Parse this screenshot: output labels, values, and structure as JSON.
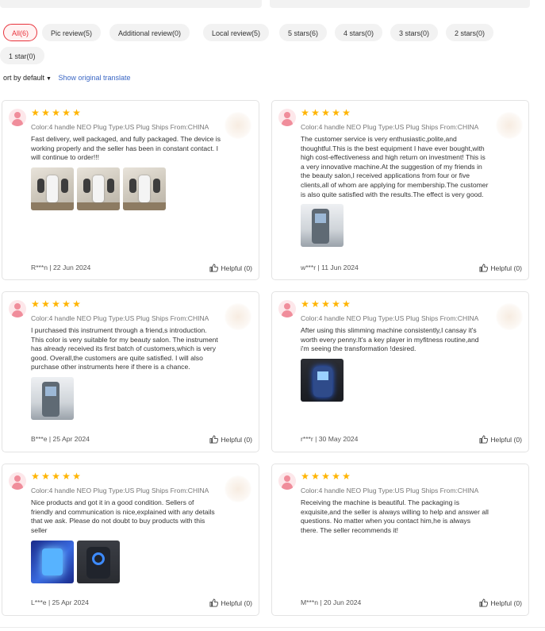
{
  "filters": [
    {
      "label": "All(6)",
      "active": true
    },
    {
      "label": "Pic review(5)",
      "active": false
    },
    {
      "label": "Additional review(0)",
      "active": false
    },
    {
      "label": "Local review(5)",
      "active": false
    },
    {
      "label": "5 stars(6)",
      "active": false
    },
    {
      "label": "4 stars(0)",
      "active": false
    },
    {
      "label": "3 stars(0)",
      "active": false
    },
    {
      "label": "2 stars(0)",
      "active": false
    },
    {
      "label": "1 star(0)",
      "active": false
    }
  ],
  "sort": {
    "label": "ort by default",
    "translate_label": "Show original translate"
  },
  "colors": {
    "accent": "#e8333c",
    "star": "#ffb400",
    "link": "#3a66c4"
  },
  "reviews": [
    {
      "rating": 5,
      "variant": "Color:4 handle NEO Plug Type:US Plug Ships From:CHINA",
      "text": [
        "Fast delivery, well packaged, and fully packaged. The device is",
        "working properly and the seller has been in constant contact. I",
        "will continue to order!!!"
      ],
      "photos": [
        "beige",
        "beige",
        "beige"
      ],
      "author": "R***n | 22 Jun 2024",
      "helpful": "Helpful (0)"
    },
    {
      "rating": 5,
      "variant": "Color:4 handle NEO Plug Type:US Plug Ships From:CHINA",
      "text": [
        "The customer service is very enthusiastic,polite,and",
        "thoughtful.This is the best equipment I have ever bought,with",
        "high cost-effectiveness and high return on investment! This is",
        "a very innovative machine.At the suggestion of my friends in",
        "the beauty salon,I received applications from four or five",
        "clients,all of whom are applying for membership.The customer",
        "is also quite satisfied with the results.The effect is very good."
      ],
      "photos": [
        "salon"
      ],
      "author": "w***r | 11 Jun 2024",
      "helpful": "Helpful (0)"
    },
    {
      "rating": 5,
      "variant": "Color:4 handle NEO Plug Type:US Plug Ships From:CHINA",
      "text": [
        "I purchased this instrument through a friend,s introduction.",
        "This color is very suitable for my beauty salon. The instrument",
        "has already received its first batch of customers,which is very",
        "good. Overall,the customers are quite satisfied. I will also",
        "purchase other instruments here if there is a chance."
      ],
      "photos": [
        "salon"
      ],
      "author": "B***e | 25 Apr 2024",
      "helpful": "Helpful (0)"
    },
    {
      "rating": 5,
      "variant": "Color:4 handle NEO Plug Type:US Plug Ships From:CHINA",
      "text": [
        "After using this slimming machine consistently,I cansay it's",
        "worth every penny.It's a key player in myfitness routine,and",
        "i'm seeing the transformation !desired."
      ],
      "photos": [
        "dark"
      ],
      "author": "r***r | 30 May 2024",
      "helpful": "Helpful (0)"
    },
    {
      "rating": 5,
      "variant": "Color:4 handle NEO Plug Type:US Plug Ships From:CHINA",
      "text": [
        "Nice products and got it in a good condition. Sellers of",
        "friendly and communication is nice,explained with any details",
        "that we ask. Please do not doubt to buy products with this",
        "seller"
      ],
      "photos": [
        "blue",
        "dark2"
      ],
      "author": "L***e | 25 Apr 2024",
      "helpful": "Helpful (0)"
    },
    {
      "rating": 5,
      "variant": "Color:4 handle NEO Plug Type:US Plug Ships From:CHINA",
      "text": [
        "Receiving the machine is beautiful. The packaging is",
        "exquisite,and the seller is always willing to help and answer all",
        "questions. No matter when you contact him,he is always",
        "there. The seller recommends it!"
      ],
      "photos": [],
      "author": "M***n | 20 Jun 2024",
      "helpful": "Helpful (0)"
    }
  ]
}
